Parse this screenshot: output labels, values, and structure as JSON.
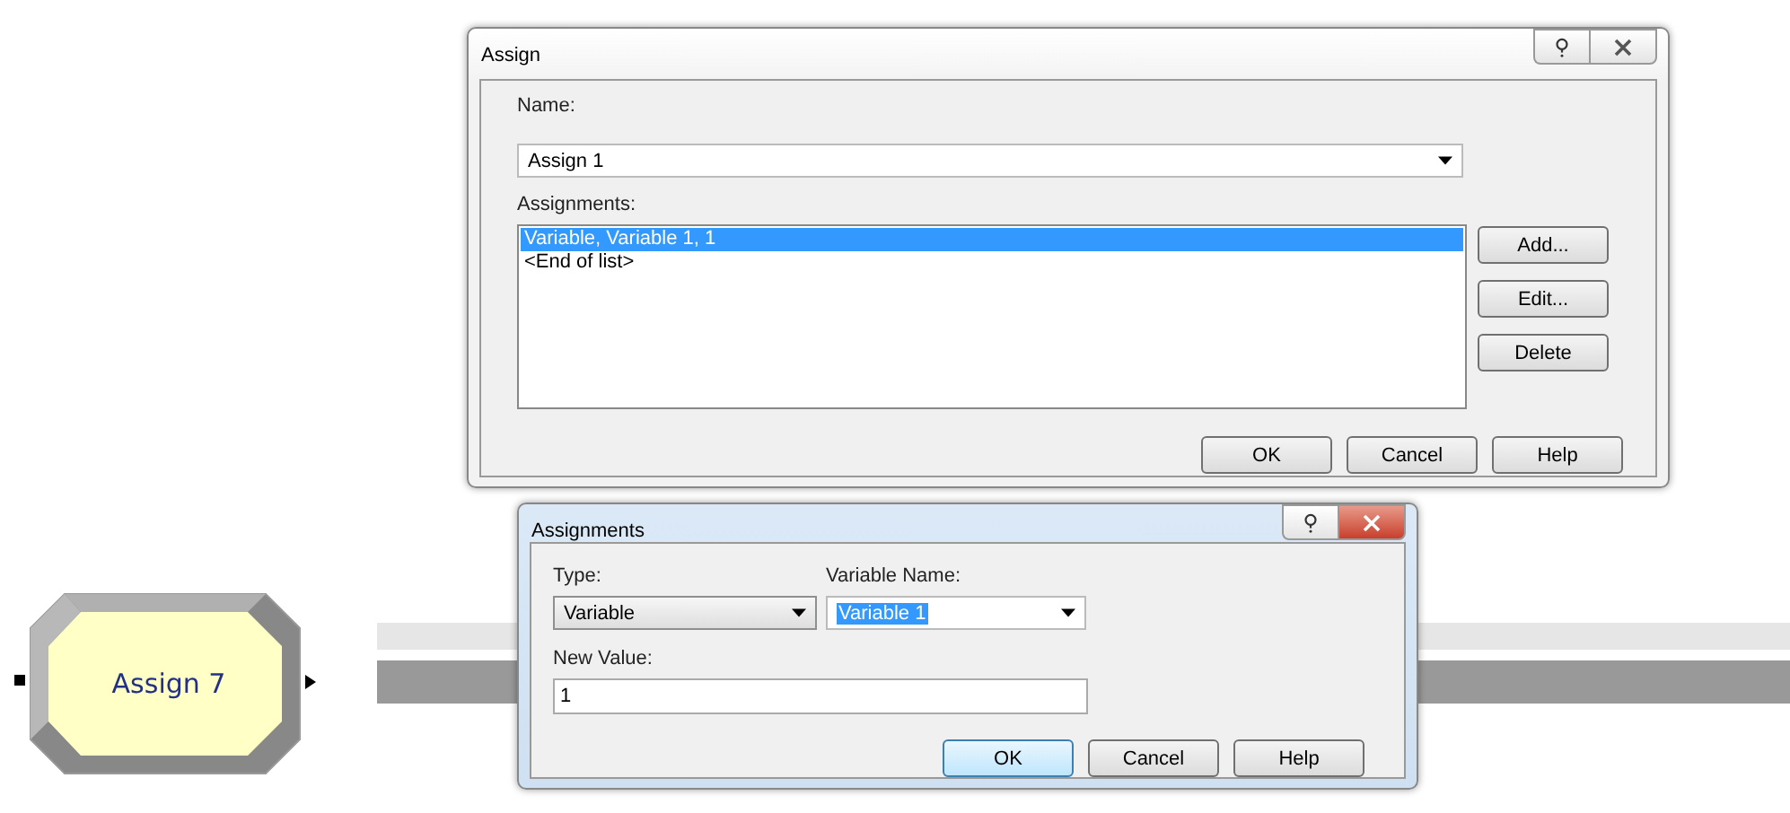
{
  "module": {
    "label": "Assign 7"
  },
  "assign_dialog": {
    "title": "Assign",
    "name_label": "Name:",
    "name_value": "Assign 1",
    "assignments_label": "Assignments:",
    "assignments": [
      {
        "text": "Variable, Variable 1, 1",
        "selected": true
      },
      {
        "text": "<End of list>",
        "selected": false
      }
    ],
    "side_buttons": [
      "Add...",
      "Edit...",
      "Delete"
    ],
    "buttons": [
      {
        "label": "OK",
        "default": false
      },
      {
        "label": "Cancel",
        "default": false
      },
      {
        "label": "Help",
        "default": false
      }
    ]
  },
  "assignments_dialog": {
    "title": "Assignments",
    "type_label": "Type:",
    "type_value": "Variable",
    "variable_name_label": "Variable Name:",
    "variable_name_value": "Variable 1",
    "new_value_label": "New Value:",
    "new_value": "1",
    "buttons": [
      {
        "label": "OK",
        "default": true
      },
      {
        "label": "Cancel",
        "default": false
      },
      {
        "label": "Help",
        "default": false
      }
    ]
  }
}
